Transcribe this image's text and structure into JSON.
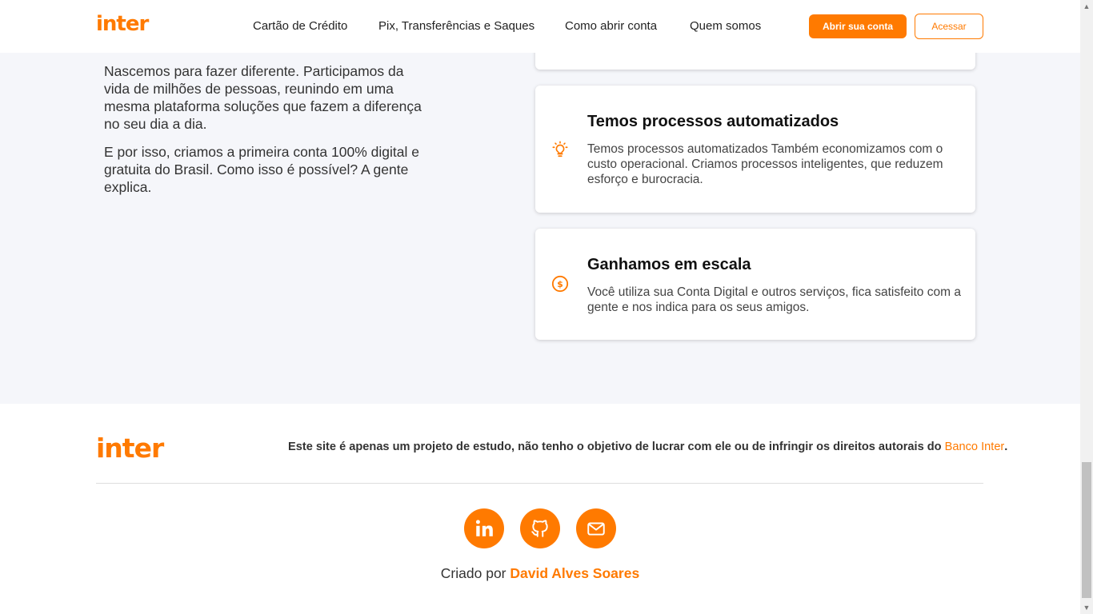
{
  "header": {
    "logo": "inter",
    "nav": [
      "Cartão de Crédito",
      "Pix, Transferências e Saques",
      "Como abrir conta",
      "Quem somos"
    ],
    "cta_primary": "Abrir sua conta",
    "cta_secondary": "Acessar"
  },
  "about": {
    "paragraphs": [
      "Nascemos para fazer diferente. Participamos da vida de milhões de pessoas, reunindo em uma mesma plataforma soluções que fazem a diferença no seu dia a dia.",
      "E por isso, criamos a primeira conta 100% digital e gratuita do Brasil. Como isso é possível? A gente explica."
    ]
  },
  "cards": [
    {
      "icon": "lightbulb-icon",
      "title": "Temos processos automatizados",
      "text": "Temos processos automatizados Também economizamos com o custo operacional. Criamos processos inteligentes, que reduzem esforço e burocracia."
    },
    {
      "icon": "dollar-coin-icon",
      "title": "Ganhamos em escala",
      "text": "Você utiliza sua Conta Digital e outros serviços, fica satisfeito com a gente e nos indica para os seus amigos."
    }
  ],
  "footer": {
    "logo": "inter",
    "disclaimer": "Este site é apenas um projeto de estudo, não tenho o objetivo de lucrar com ele ou de infringir os direitos autorais do ",
    "disclaimer_link": "Banco Inter",
    "disclaimer_end": ".",
    "social": [
      "linkedin-icon",
      "github-icon",
      "mail-icon"
    ],
    "credit_prefix": "Criado por ",
    "credit_author": "David Alves Soares"
  },
  "colors": {
    "accent": "#ff7a00",
    "background": "#f5f6fa",
    "surface": "#ffffff"
  }
}
